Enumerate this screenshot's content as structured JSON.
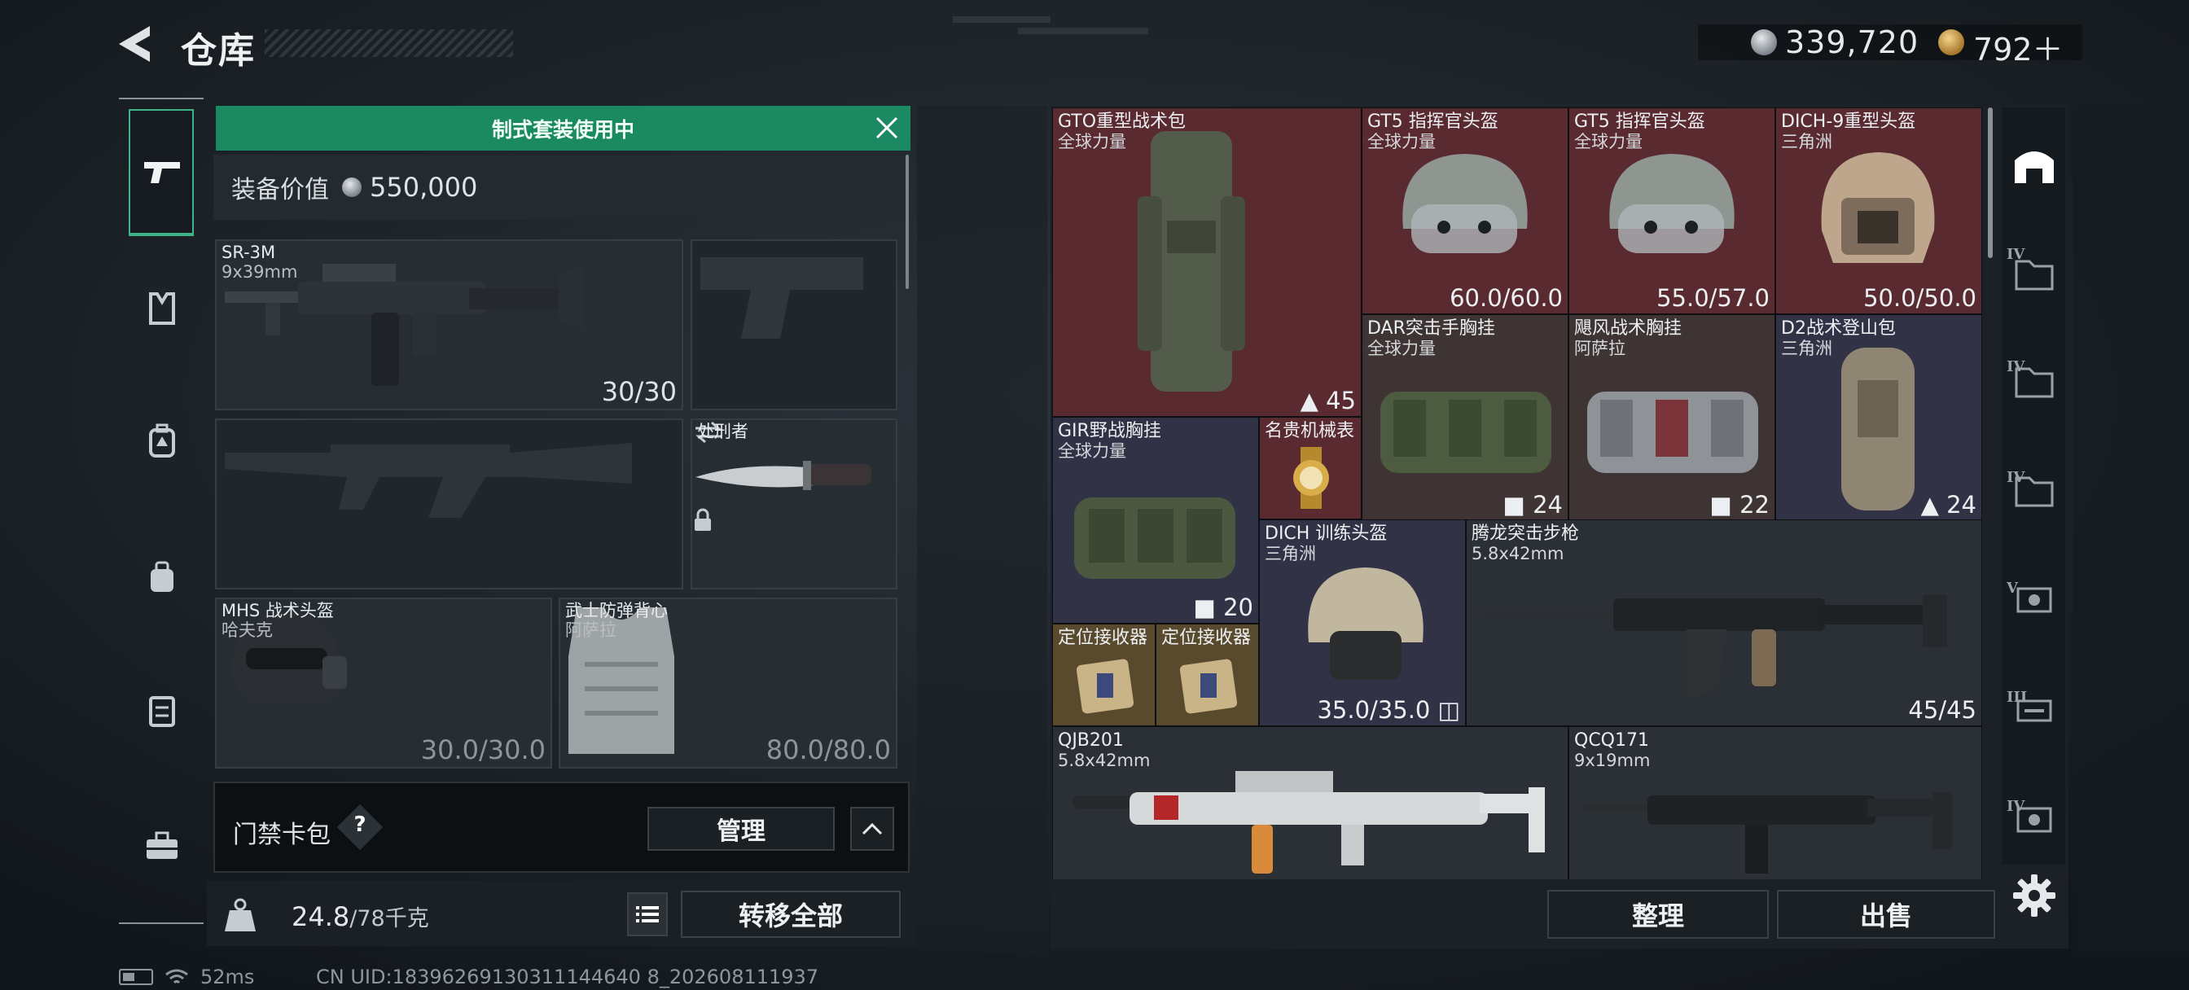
{
  "header": {
    "title": "仓库",
    "currency_money": "339,720",
    "currency_bond": "792＋"
  },
  "loadout": {
    "banner": "制式套装使用中",
    "value_label": "装备价值",
    "value_amount": "550,000",
    "slots": [
      {
        "name": "SR-3M",
        "sub": "9x39mm",
        "count": "30/30",
        "art": "rifle-icon"
      },
      {
        "name": "",
        "sub": "",
        "count": "",
        "art": "pistol-silhouette-icon"
      },
      {
        "name": "",
        "sub": "",
        "count": "",
        "art": "rifle-silhouette-icon"
      },
      {
        "name": "处刑者",
        "sub": "",
        "count": "",
        "art": "knife-icon"
      },
      {
        "name": "MHS 战术头盔",
        "sub": "哈夫克",
        "count": "30.0/30.0",
        "art": "helmet-icon"
      },
      {
        "name": "武士防弹背心",
        "sub": "阿萨拉",
        "count": "80.0/80.0",
        "art": "vest-icon"
      }
    ],
    "card_bag_label": "门禁卡包",
    "card_bag_help": "?",
    "manage_label": "管理",
    "weight_value": "24.8",
    "weight_capacity": "/78千克",
    "transfer_all_label": "转移全部"
  },
  "status": {
    "ping": "52ms",
    "uid": "CN UID:18396269130311144640 8_202608111937"
  },
  "inventory": {
    "items": [
      {
        "name": "GTO重型战术包",
        "sub": "全球力量",
        "count": "45",
        "rarity": "red"
      },
      {
        "name": "GT5 指挥官头盔",
        "sub": "全球力量",
        "count": "60.0/60.0",
        "rarity": "red"
      },
      {
        "name": "GT5 指挥官头盔",
        "sub": "全球力量",
        "count": "55.0/57.0",
        "rarity": "red"
      },
      {
        "name": "DICH-9重型头盔",
        "sub": "三角洲",
        "count": "50.0/50.0",
        "rarity": "red"
      },
      {
        "name": "DAR突击手胸挂",
        "sub": "全球力量",
        "count": "24",
        "rarity": "brown"
      },
      {
        "name": "飓风战术胸挂",
        "sub": "阿萨拉",
        "count": "22",
        "rarity": "brown"
      },
      {
        "name": "D2战术登山包",
        "sub": "三角洲",
        "count": "24",
        "rarity": "purple"
      },
      {
        "name": "GIR野战胸挂",
        "sub": "全球力量",
        "count": "20",
        "rarity": "purple"
      },
      {
        "name": "名贵机械表",
        "sub": "",
        "count": "",
        "rarity": "red"
      },
      {
        "name": "DICH 训练头盔",
        "sub": "三角洲",
        "count": "35.0/35.0",
        "rarity": "purple"
      },
      {
        "name": "腾龙突击步枪",
        "sub": "5.8x42mm",
        "count": "45/45",
        "rarity": "gray"
      },
      {
        "name": "定位接收器",
        "sub": "",
        "count": "",
        "rarity": "red"
      },
      {
        "name": "定位接收器",
        "sub": "",
        "count": "",
        "rarity": "red"
      },
      {
        "name": "QJB201",
        "sub": "5.8x42mm",
        "count": "",
        "rarity": "gray"
      },
      {
        "name": "QCQ171",
        "sub": "9x19mm",
        "count": "",
        "rarity": "gray"
      }
    ],
    "tab_levels": [
      "IV",
      "IV",
      "IV",
      "V",
      "III",
      "IV"
    ],
    "sort_label": "整理",
    "sell_label": "出售"
  }
}
